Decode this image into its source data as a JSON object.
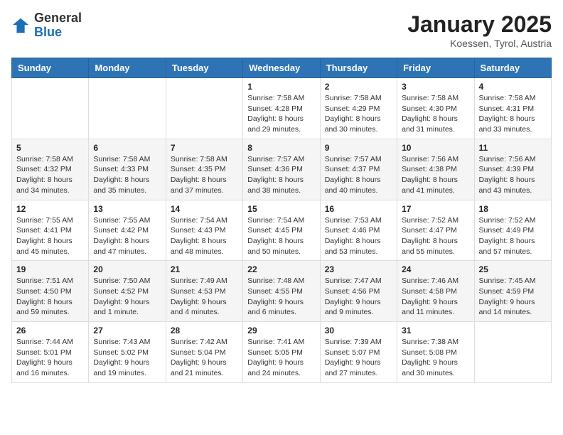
{
  "header": {
    "logo_line1": "General",
    "logo_line2": "Blue",
    "month": "January 2025",
    "location": "Koessen, Tyrol, Austria"
  },
  "days_of_week": [
    "Sunday",
    "Monday",
    "Tuesday",
    "Wednesday",
    "Thursday",
    "Friday",
    "Saturday"
  ],
  "weeks": [
    [
      {
        "day": "",
        "info": ""
      },
      {
        "day": "",
        "info": ""
      },
      {
        "day": "",
        "info": ""
      },
      {
        "day": "1",
        "info": "Sunrise: 7:58 AM\nSunset: 4:28 PM\nDaylight: 8 hours\nand 29 minutes."
      },
      {
        "day": "2",
        "info": "Sunrise: 7:58 AM\nSunset: 4:29 PM\nDaylight: 8 hours\nand 30 minutes."
      },
      {
        "day": "3",
        "info": "Sunrise: 7:58 AM\nSunset: 4:30 PM\nDaylight: 8 hours\nand 31 minutes."
      },
      {
        "day": "4",
        "info": "Sunrise: 7:58 AM\nSunset: 4:31 PM\nDaylight: 8 hours\nand 33 minutes."
      }
    ],
    [
      {
        "day": "5",
        "info": "Sunrise: 7:58 AM\nSunset: 4:32 PM\nDaylight: 8 hours\nand 34 minutes."
      },
      {
        "day": "6",
        "info": "Sunrise: 7:58 AM\nSunset: 4:33 PM\nDaylight: 8 hours\nand 35 minutes."
      },
      {
        "day": "7",
        "info": "Sunrise: 7:58 AM\nSunset: 4:35 PM\nDaylight: 8 hours\nand 37 minutes."
      },
      {
        "day": "8",
        "info": "Sunrise: 7:57 AM\nSunset: 4:36 PM\nDaylight: 8 hours\nand 38 minutes."
      },
      {
        "day": "9",
        "info": "Sunrise: 7:57 AM\nSunset: 4:37 PM\nDaylight: 8 hours\nand 40 minutes."
      },
      {
        "day": "10",
        "info": "Sunrise: 7:56 AM\nSunset: 4:38 PM\nDaylight: 8 hours\nand 41 minutes."
      },
      {
        "day": "11",
        "info": "Sunrise: 7:56 AM\nSunset: 4:39 PM\nDaylight: 8 hours\nand 43 minutes."
      }
    ],
    [
      {
        "day": "12",
        "info": "Sunrise: 7:55 AM\nSunset: 4:41 PM\nDaylight: 8 hours\nand 45 minutes."
      },
      {
        "day": "13",
        "info": "Sunrise: 7:55 AM\nSunset: 4:42 PM\nDaylight: 8 hours\nand 47 minutes."
      },
      {
        "day": "14",
        "info": "Sunrise: 7:54 AM\nSunset: 4:43 PM\nDaylight: 8 hours\nand 48 minutes."
      },
      {
        "day": "15",
        "info": "Sunrise: 7:54 AM\nSunset: 4:45 PM\nDaylight: 8 hours\nand 50 minutes."
      },
      {
        "day": "16",
        "info": "Sunrise: 7:53 AM\nSunset: 4:46 PM\nDaylight: 8 hours\nand 53 minutes."
      },
      {
        "day": "17",
        "info": "Sunrise: 7:52 AM\nSunset: 4:47 PM\nDaylight: 8 hours\nand 55 minutes."
      },
      {
        "day": "18",
        "info": "Sunrise: 7:52 AM\nSunset: 4:49 PM\nDaylight: 8 hours\nand 57 minutes."
      }
    ],
    [
      {
        "day": "19",
        "info": "Sunrise: 7:51 AM\nSunset: 4:50 PM\nDaylight: 8 hours\nand 59 minutes."
      },
      {
        "day": "20",
        "info": "Sunrise: 7:50 AM\nSunset: 4:52 PM\nDaylight: 9 hours\nand 1 minute."
      },
      {
        "day": "21",
        "info": "Sunrise: 7:49 AM\nSunset: 4:53 PM\nDaylight: 9 hours\nand 4 minutes."
      },
      {
        "day": "22",
        "info": "Sunrise: 7:48 AM\nSunset: 4:55 PM\nDaylight: 9 hours\nand 6 minutes."
      },
      {
        "day": "23",
        "info": "Sunrise: 7:47 AM\nSunset: 4:56 PM\nDaylight: 9 hours\nand 9 minutes."
      },
      {
        "day": "24",
        "info": "Sunrise: 7:46 AM\nSunset: 4:58 PM\nDaylight: 9 hours\nand 11 minutes."
      },
      {
        "day": "25",
        "info": "Sunrise: 7:45 AM\nSunset: 4:59 PM\nDaylight: 9 hours\nand 14 minutes."
      }
    ],
    [
      {
        "day": "26",
        "info": "Sunrise: 7:44 AM\nSunset: 5:01 PM\nDaylight: 9 hours\nand 16 minutes."
      },
      {
        "day": "27",
        "info": "Sunrise: 7:43 AM\nSunset: 5:02 PM\nDaylight: 9 hours\nand 19 minutes."
      },
      {
        "day": "28",
        "info": "Sunrise: 7:42 AM\nSunset: 5:04 PM\nDaylight: 9 hours\nand 21 minutes."
      },
      {
        "day": "29",
        "info": "Sunrise: 7:41 AM\nSunset: 5:05 PM\nDaylight: 9 hours\nand 24 minutes."
      },
      {
        "day": "30",
        "info": "Sunrise: 7:39 AM\nSunset: 5:07 PM\nDaylight: 9 hours\nand 27 minutes."
      },
      {
        "day": "31",
        "info": "Sunrise: 7:38 AM\nSunset: 5:08 PM\nDaylight: 9 hours\nand 30 minutes."
      },
      {
        "day": "",
        "info": ""
      }
    ]
  ]
}
